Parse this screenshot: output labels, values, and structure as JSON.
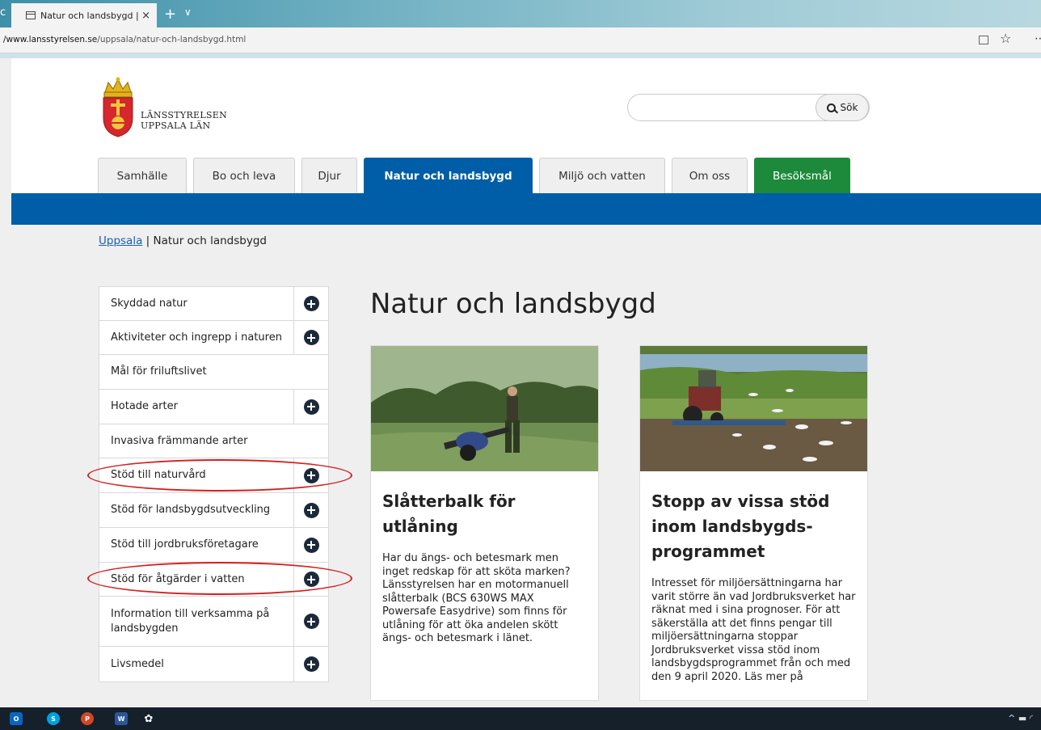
{
  "browser": {
    "tab_title": "Natur och landsbygd | L",
    "tab_close": "×",
    "new_tab": "+",
    "tab_list": "∨",
    "tab_edge": "c",
    "url_host": "/www.lansstyrelsen.se",
    "url_path": "/uppsala/natur-och-landsbygd.html",
    "favorite_icon": "☆",
    "more_icon": "⋯"
  },
  "header": {
    "logo_line1": "LÄNSSTYRELSEN",
    "logo_line2": "UPPSALA LÄN",
    "search_placeholder": "",
    "search_button": "Sök"
  },
  "nav": {
    "tabs": [
      {
        "label": "Samhälle"
      },
      {
        "label": "Bo och leva"
      },
      {
        "label": "Djur"
      },
      {
        "label": "Natur och landsbygd"
      },
      {
        "label": "Miljö och vatten"
      },
      {
        "label": "Om oss"
      },
      {
        "label": "Besöksmål"
      }
    ],
    "active_color": "#005ea8",
    "green_color": "#1c8a3a"
  },
  "breadcrumb": {
    "home": "Uppsala",
    "separator": " | ",
    "current": "Natur och landsbygd"
  },
  "sidebar": {
    "items": [
      {
        "label": "Skyddad natur",
        "expandable": true
      },
      {
        "label": "Aktiviteter och ingrepp i naturen",
        "expandable": true
      },
      {
        "label": "Mål för friluftslivet",
        "expandable": false
      },
      {
        "label": "Hotade arter",
        "expandable": true
      },
      {
        "label": "Invasiva främmande arter",
        "expandable": false
      },
      {
        "label": "Stöd till naturvård",
        "expandable": true,
        "circled": true
      },
      {
        "label": "Stöd för landsbygdsutveckling",
        "expandable": true
      },
      {
        "label": "Stöd till jordbruksföretagare",
        "expandable": true
      },
      {
        "label": "Stöd för åtgärder i vatten",
        "expandable": true,
        "circled": true
      },
      {
        "label": "Information till verksamma på landsbygden",
        "expandable": true
      },
      {
        "label": "Livsmedel",
        "expandable": true
      }
    ]
  },
  "main": {
    "title": "Natur och landsbygd",
    "cards": [
      {
        "title": "Slåtterbalk för utlåning",
        "text": "Har du ängs- och betesmark men inget redskap för att sköta marken? Länsstyrelsen har en motormanuell slåtterbalk (BCS 630WS MAX Powersafe Easydrive) som finns för utlåning för att öka andelen skött ängs- och betesmark i länet."
      },
      {
        "title": "Stopp av vissa stöd inom landsbygds-programmet",
        "text": "Intresset för miljöersättningarna har varit större än vad Jordbruksverket har räknat med i sina prognoser. För att säkerställa att det finns pengar till miljöersättningarna stoppar Jordbruksverket vissa stöd inom landsbygdsprogrammet från och med den 9 april 2020. Läs mer på"
      }
    ]
  },
  "taskbar": {
    "apps": [
      {
        "name": "outlook-icon",
        "letter": "O",
        "color": "#0a64c4"
      },
      {
        "name": "skype-icon",
        "letter": "S",
        "color": "#00a1e4"
      },
      {
        "name": "powerpoint-icon",
        "letter": "P",
        "color": "#d24726"
      },
      {
        "name": "word-icon",
        "letter": "W",
        "color": "#2b579a"
      },
      {
        "name": "settings-icon",
        "letter": "✿",
        "color": "transparent"
      }
    ],
    "tray": "^ ▬ ◜"
  }
}
